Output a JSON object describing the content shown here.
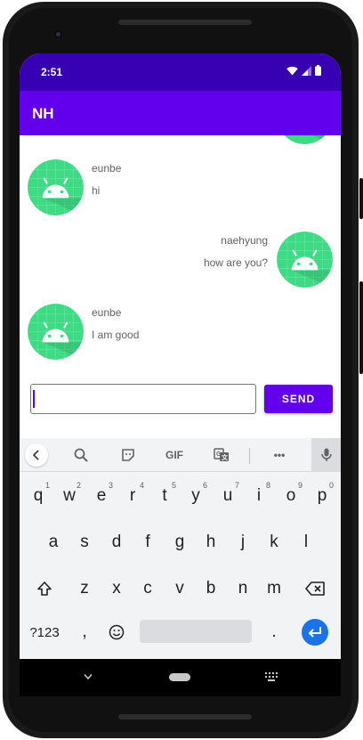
{
  "status_bar": {
    "time": "2:51"
  },
  "app_bar": {
    "title": "NH"
  },
  "messages": [
    {
      "sender": "",
      "text": "",
      "side": "right",
      "partial": true
    },
    {
      "sender": "eunbe",
      "text": "hi",
      "side": "left"
    },
    {
      "sender": "naehyung",
      "text": "how are you?",
      "side": "right"
    },
    {
      "sender": "eunbe",
      "text": "I am good",
      "side": "left"
    }
  ],
  "composer": {
    "input_value": "",
    "input_placeholder": "",
    "send_label": "SEND"
  },
  "keyboard": {
    "toolbar": {
      "gif_label": "GIF",
      "more_label": "•••"
    },
    "row1": [
      {
        "k": "q",
        "n": "1"
      },
      {
        "k": "w",
        "n": "2"
      },
      {
        "k": "e",
        "n": "3"
      },
      {
        "k": "r",
        "n": "4"
      },
      {
        "k": "t",
        "n": "5"
      },
      {
        "k": "y",
        "n": "6"
      },
      {
        "k": "u",
        "n": "7"
      },
      {
        "k": "i",
        "n": "8"
      },
      {
        "k": "o",
        "n": "9"
      },
      {
        "k": "p",
        "n": "0"
      }
    ],
    "row2": [
      "a",
      "s",
      "d",
      "f",
      "g",
      "h",
      "j",
      "k",
      "l"
    ],
    "row3": [
      "z",
      "x",
      "c",
      "v",
      "b",
      "n",
      "m"
    ],
    "symbols_label": "?123",
    "comma_label": ",",
    "period_label": "."
  },
  "colors": {
    "status_bar": "#3700b3",
    "primary": "#6200ee",
    "avatar_bg": "#3ddc84",
    "enter_key": "#1a73e8"
  }
}
